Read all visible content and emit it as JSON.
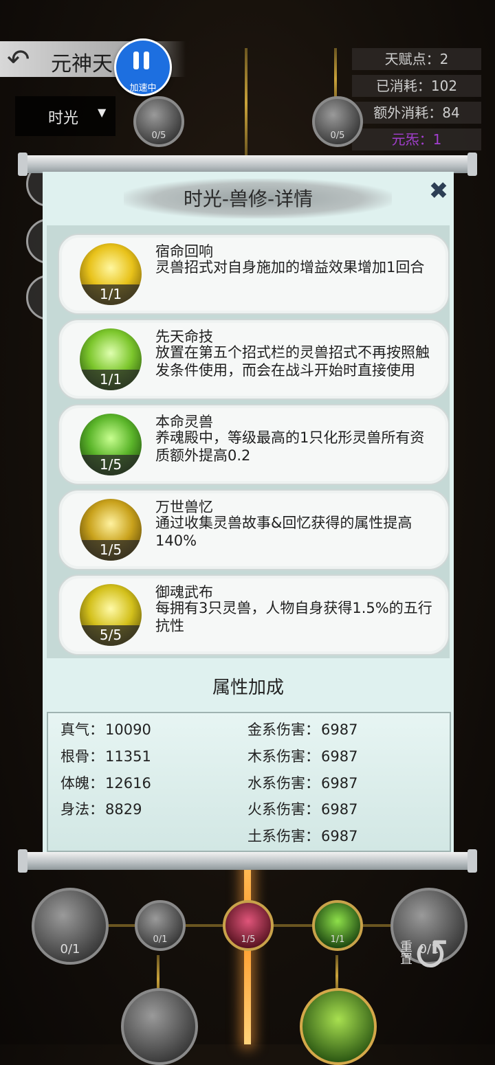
{
  "top_bar": {
    "back_icon": "back-arrow-icon",
    "title": "元神天"
  },
  "speed_badge": {
    "icon": "pause-icon",
    "label": "加速中"
  },
  "time_select": {
    "value": "时光",
    "icon": "caret-down-icon"
  },
  "stats": [
    {
      "label": "天赋点：2"
    },
    {
      "label": "已消耗：102"
    },
    {
      "label": "额外消耗：84"
    },
    {
      "label": "元炁：1"
    }
  ],
  "bg_nodes": {
    "top_left": "0/5",
    "top_right": "0/5",
    "bottom": [
      "0/1",
      "0/1",
      "1/5",
      "1/1"
    ],
    "bottom_right": "0/1"
  },
  "panel": {
    "title": "时光-兽修-详情",
    "close_icon": "close-icon",
    "skills": [
      {
        "name": "宿命回响",
        "desc": "灵兽招式对自身施加的增益效果增加1回合",
        "level": "1/1",
        "color": "#e8c21a"
      },
      {
        "name": "先天命技",
        "desc": "放置在第五个招式栏的灵兽招式不再按照触发条件使用，而会在战斗开始时直接使用",
        "level": "1/1",
        "color": "#7cc62c"
      },
      {
        "name": "本命灵兽",
        "desc": "养魂殿中，等级最高的1只化形灵兽所有资质额外提高0.2",
        "level": "1/5",
        "color": "#5bb52a"
      },
      {
        "name": "万世兽忆",
        "desc": "通过收集灵兽故事&回忆获得的属性提高140%",
        "level": "1/5",
        "color": "#c9a21c"
      },
      {
        "name": "御魂武布",
        "desc": "每拥有3只灵兽，人物自身获得1.5%的五行抗性",
        "level": "5/5",
        "color": "#d3c01b"
      }
    ],
    "attr_title": "属性加成",
    "attrs_left": [
      {
        "label": "真气：",
        "value": "10090"
      },
      {
        "label": "根骨：",
        "value": "11351"
      },
      {
        "label": "体魄：",
        "value": "12616"
      },
      {
        "label": "身法：",
        "value": "8829"
      }
    ],
    "attrs_right": [
      {
        "label": "金系伤害：",
        "value": "6987"
      },
      {
        "label": "木系伤害：",
        "value": "6987"
      },
      {
        "label": "水系伤害：",
        "value": "6987"
      },
      {
        "label": "火系伤害：",
        "value": "6987"
      },
      {
        "label": "土系伤害：",
        "value": "6987"
      }
    ]
  },
  "reset_button": {
    "label": "重置",
    "icon": "reset-arrow-icon"
  }
}
